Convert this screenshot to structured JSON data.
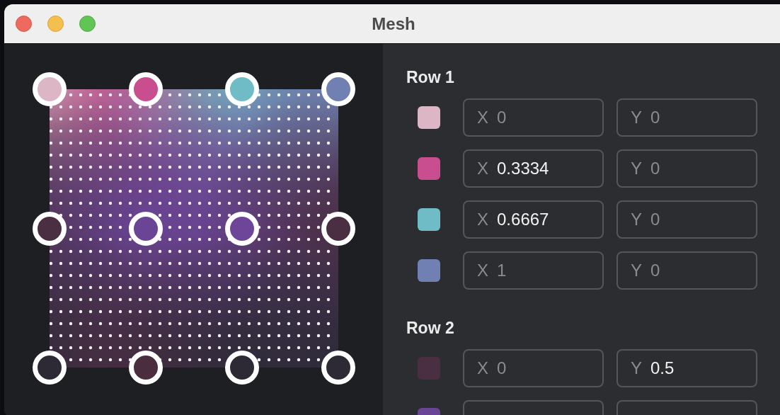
{
  "window": {
    "title": "Mesh"
  },
  "canvas": {
    "handles": [
      [
        {
          "color": "#dcb6c4"
        },
        {
          "color": "#c84e8f"
        },
        {
          "color": "#70bcc6"
        },
        {
          "color": "#7180b3"
        }
      ],
      [
        {
          "color": "#4a2f42"
        },
        {
          "color": "#6a4596"
        },
        {
          "color": "#6e4699"
        },
        {
          "color": "#4a2f42"
        }
      ],
      [
        {
          "color": "#2d2a36"
        },
        {
          "color": "#4b2d40"
        },
        {
          "color": "#2d2a36"
        },
        {
          "color": "#2d2a36"
        }
      ]
    ]
  },
  "panel": {
    "rows": [
      {
        "title": "Row 1",
        "points": [
          {
            "color": "#dcb6c4",
            "x": {
              "label": "X",
              "placeholder": "0"
            },
            "y": {
              "label": "Y",
              "placeholder": "0"
            }
          },
          {
            "color": "#c84e8f",
            "x": {
              "label": "X",
              "value": "0.3334"
            },
            "y": {
              "label": "Y",
              "placeholder": "0"
            }
          },
          {
            "color": "#70bcc6",
            "x": {
              "label": "X",
              "value": "0.6667"
            },
            "y": {
              "label": "Y",
              "placeholder": "0"
            }
          },
          {
            "color": "#7180b3",
            "x": {
              "label": "X",
              "placeholder": "1"
            },
            "y": {
              "label": "Y",
              "placeholder": "0"
            }
          }
        ]
      },
      {
        "title": "Row 2",
        "points": [
          {
            "color": "#4a2f42",
            "x": {
              "label": "X",
              "placeholder": "0"
            },
            "y": {
              "label": "Y",
              "value": "0.5"
            }
          },
          {
            "color": "#6a4596"
          }
        ]
      }
    ]
  }
}
